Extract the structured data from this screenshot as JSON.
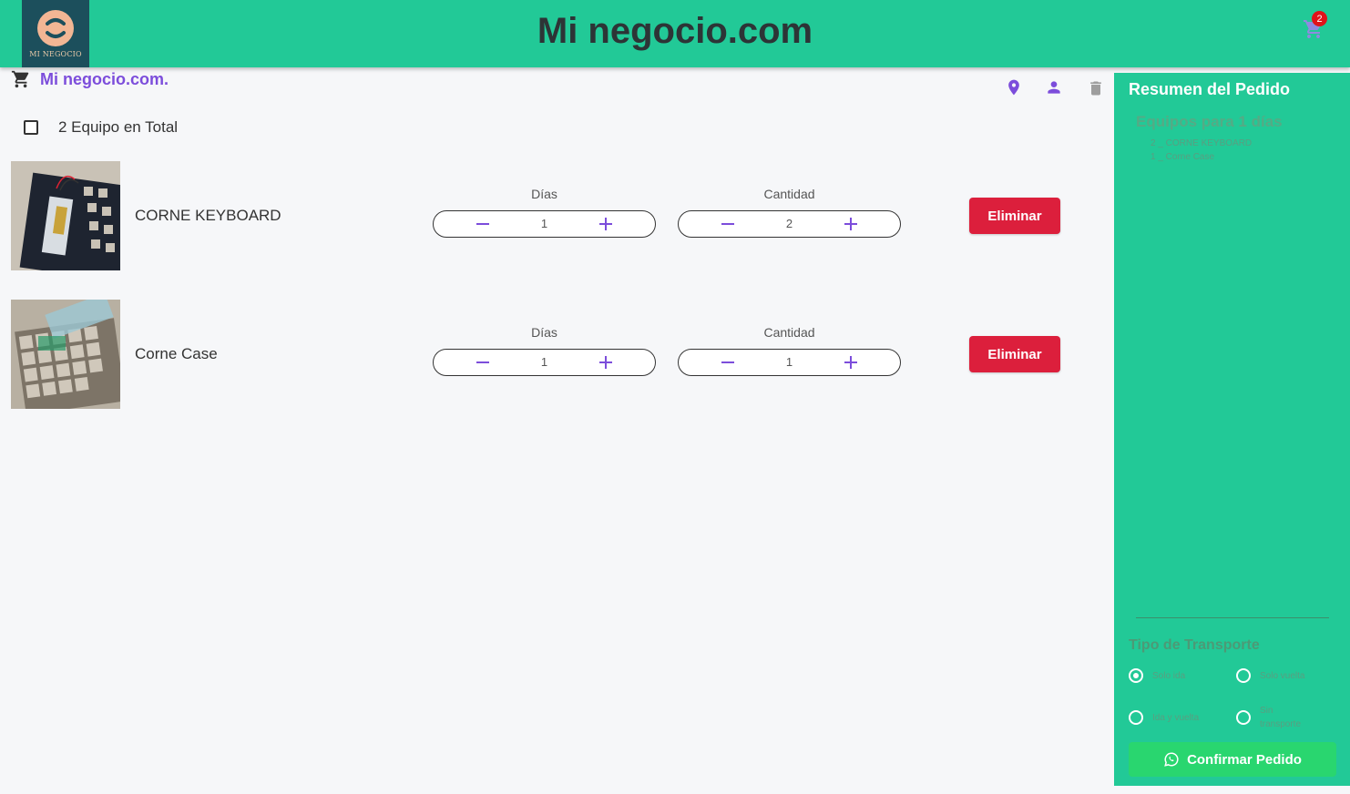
{
  "header": {
    "logo_text": "MI NEGOCIO",
    "site_title": "Mi negocio.com",
    "cart_count": "2"
  },
  "main": {
    "heading": "Mi negocio.com.",
    "select_all_label": "2 Equipo en Total",
    "items": [
      {
        "name": "CORNE KEYBOARD",
        "days_label": "Días",
        "days": "1",
        "qty_label": "Cantidad",
        "qty": "2",
        "delete_label": "Eliminar"
      },
      {
        "name": "Corne Case",
        "days_label": "Días",
        "days": "1",
        "qty_label": "Cantidad",
        "qty": "1",
        "delete_label": "Eliminar"
      }
    ]
  },
  "sidebar": {
    "title": "Resumen del Pedido",
    "subtitle": "Equipos para 1 días",
    "lines": [
      "2 _ CORNE KEYBOARD",
      "1 _ Corne Case"
    ],
    "transport_title": "Tipo de Transporte",
    "transport_options": [
      {
        "label": "Solo ida",
        "selected": true
      },
      {
        "label": "Solo vuelta",
        "selected": false
      },
      {
        "label": "Ida y vuelta",
        "selected": false
      },
      {
        "label": "Sin transporte",
        "selected": false
      }
    ],
    "confirm_label": "Confirmar Pedido"
  },
  "colors": {
    "header_bg": "#22c997",
    "accent_purple": "#7c4ddb",
    "delete_red": "#dc1f3c",
    "confirm_green": "#29d66f",
    "badge_red": "#e0131a"
  },
  "icons": [
    "cart-icon",
    "location-icon",
    "user-icon",
    "trash-icon",
    "minus-icon",
    "plus-icon",
    "whatsapp-icon"
  ]
}
